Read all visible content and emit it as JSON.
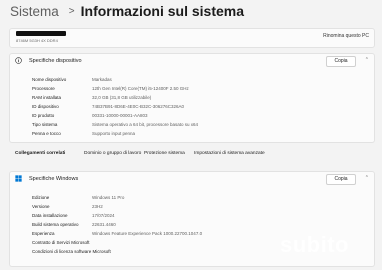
{
  "breadcrumb": {
    "parent": "Sistema",
    "separator": ">",
    "current": "Informazioni sul sistema"
  },
  "device": {
    "specs": "8746M 5G3H 4X DDR4",
    "rename_label": "Rinomina questo PC"
  },
  "device_specs": {
    "title": "Specifiche dispositivo",
    "copy_label": "Copia",
    "rows": [
      {
        "key": "Nome dispositivo",
        "value": "Markadas"
      },
      {
        "key": "Processore",
        "value": "12th Gen Intel(R) Core(TM) i5-12400F   2.50 GHz"
      },
      {
        "key": "RAM installata",
        "value": "32,0 GB (31,8 GB utilizzabile)"
      },
      {
        "key": "ID dispositivo",
        "value": "74B37B91-8D6E-4E0C-B32C-306276C326A0"
      },
      {
        "key": "ID prodotto",
        "value": "00331-10000-00001-AA803"
      },
      {
        "key": "Tipo sistema",
        "value": "Sistema operativo a 64 bit, processore basato su x64"
      },
      {
        "key": "Penna e tocco",
        "value": "Supporto input penna"
      }
    ]
  },
  "related": {
    "title": "Collegamenti correlati",
    "links": [
      "Dominio o gruppo di lavoro",
      "Protezione sistema",
      "Impostazioni di sistema avanzate"
    ]
  },
  "windows_specs": {
    "title": "Specifiche Windows",
    "copy_label": "Copia",
    "rows": [
      {
        "key": "Edizione",
        "value": "Windows 11 Pro"
      },
      {
        "key": "Versione",
        "value": "23H2"
      },
      {
        "key": "Data installazione",
        "value": "17/07/2024"
      },
      {
        "key": "Build sistema operativo",
        "value": "22631.4460"
      },
      {
        "key": "Esperienza",
        "value": "Windows Feature Experience Pack 1000.22700.1047.0"
      }
    ],
    "links": [
      "Contratto di Servizi Microsoft",
      "Condizioni di licenza software Microsoft"
    ]
  },
  "watermark": "subito",
  "colors": {
    "accent": "#0067c0",
    "windows_logo": "#0078d4",
    "background": "#f3f3f3",
    "card": "#fbfbfb"
  }
}
